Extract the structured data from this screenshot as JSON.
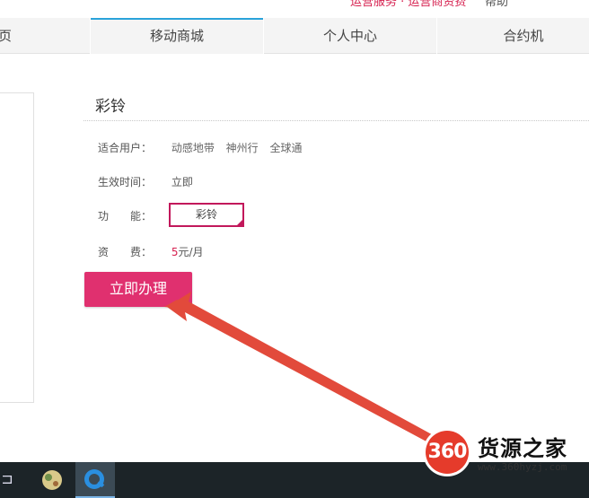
{
  "top_strip": {
    "left_text": "运营服务 · 运营商资费",
    "right_text": "帮助"
  },
  "nav": {
    "tabs": [
      {
        "label": "首页",
        "visible_label": "首页"
      },
      {
        "label": "移动商城"
      },
      {
        "label": "个人中心"
      },
      {
        "label": "合约机"
      }
    ]
  },
  "product": {
    "title": "彩铃",
    "suitable_label": "适合用户：",
    "suitable_users": [
      "动感地带",
      "神州行",
      "全球通"
    ],
    "effective_label": "生效时间：",
    "effective_value": "立即",
    "feature_label": "功　　能：",
    "feature_value": "彩铃",
    "fee_label": "资　　费：",
    "fee_number": "5",
    "fee_unit": "元/月",
    "apply_button": "立即办理"
  },
  "colors": {
    "accent": "#e0306f",
    "nav_active": "#2aa3da",
    "arrow": "#e24a3b",
    "taskbar": "#1c2428"
  },
  "watermark": {
    "logo_text": "360",
    "title": "货源之家",
    "url": "www.360hyzj.com"
  },
  "taskbar": {
    "icons": [
      "task-view-icon",
      "app-icon-ball",
      "app-icon-q"
    ]
  }
}
